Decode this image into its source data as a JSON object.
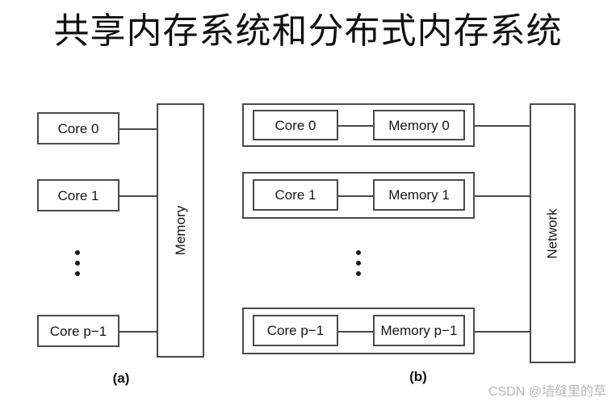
{
  "title": "共享内存系统和分布式内存系统",
  "shared_memory": {
    "caption": "(a)",
    "cores": [
      {
        "label": "Core 0"
      },
      {
        "label": "Core 1"
      },
      {
        "label": "Core p−1"
      }
    ],
    "memory_label": "Memory",
    "ellipsis": "⋮"
  },
  "distributed_memory": {
    "caption": "(b)",
    "nodes": [
      {
        "core": "Core 0",
        "memory": "Memory 0"
      },
      {
        "core": "Core 1",
        "memory": "Memory 1"
      },
      {
        "core": "Core p−1",
        "memory": "Memory p−1"
      }
    ],
    "network_label": "Network",
    "ellipsis": "⋮"
  },
  "watermark": "CSDN @墙缝里的草",
  "colors": {
    "stroke": "#4a4a4a",
    "text": "#161616",
    "background": "#ffffff",
    "watermark": "#b9b9b9"
  }
}
